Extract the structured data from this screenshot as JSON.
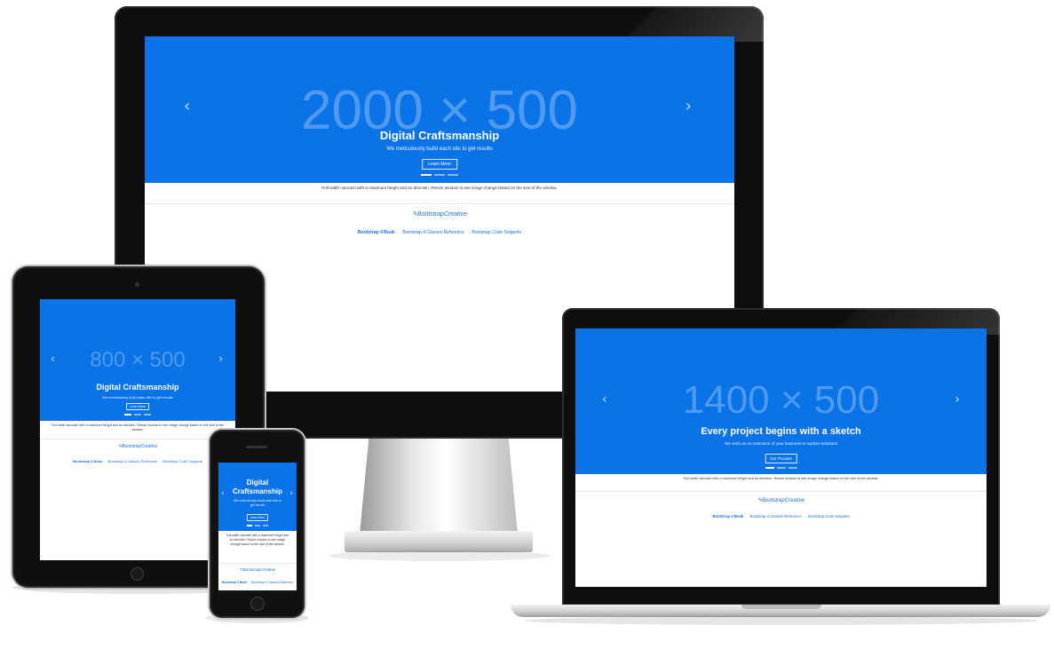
{
  "monitor": {
    "placeholder": "2000 × 500",
    "title": "Digital Craftsmanship",
    "subtitle": "We meticulously build each site to get results",
    "button": "Learn More",
    "prev": "‹",
    "next": "›",
    "description": "Full-width carousel with a maximum height and an direction. Resize window to see image change based on the size of the window.",
    "logo": "✎BootstrapCreative",
    "links": [
      "Bootstrap 4 Book",
      "Bootstrap 4 Classes Reference",
      "Bootstrap Code Snippets"
    ]
  },
  "tablet": {
    "placeholder": "800 × 500",
    "title": "Digital Craftsmanship",
    "subtitle": "We meticulously build each site to get results",
    "button": "Learn More",
    "prev": "‹",
    "next": "›",
    "description": "Full-width carousel with a maximum height and an direction. Resize window to see image change based on the size of the window.",
    "logo": "✎BootstrapCreative",
    "links": [
      "Bootstrap 4 Book",
      "Bootstrap 4 Classes Reference",
      "Bootstrap Code Snippets"
    ]
  },
  "phone": {
    "title": "Digital Craftsmanship",
    "subtitle": "We meticulously build each site to get results",
    "button": "Learn More",
    "prev": "‹",
    "next": "›",
    "description": "Full-width carousel with a maximum height and an direction. Resize window to see image change based on the size of the window.",
    "logo": "✎BootstrapCreative",
    "links": [
      "Bootstrap 4 Book",
      "Bootstrap 4 Classes Reference"
    ]
  },
  "laptop": {
    "placeholder": "1400 × 500",
    "title": "Every project begins with a sketch",
    "subtitle": "We work as an extension of your business to explore solutions",
    "button": "Our Process",
    "prev": "‹",
    "next": "›",
    "description": "Full-width carousel with a maximum height and an direction. Resize window to see image change based on the size of the window.",
    "logo": "✎BootstrapCreative",
    "links": [
      "Bootstrap 4 Book",
      "Bootstrap 4 Classes Reference",
      "Bootstrap Code Snippets"
    ]
  },
  "colors": {
    "hero_blue": "#0b73e8",
    "link_blue": "#1e6fd9",
    "bezel": "#0e0e0e"
  }
}
